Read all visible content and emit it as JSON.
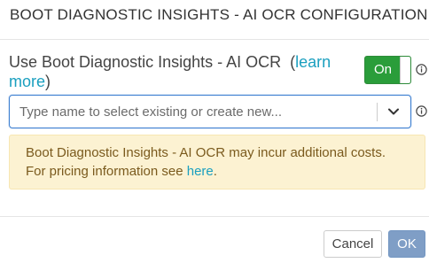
{
  "dialog": {
    "title": "BOOT DIAGNOSTIC INSIGHTS - AI OCR CONFIGURATION"
  },
  "setting": {
    "label": "Use Boot Diagnostic Insights - AI OCR",
    "paren_open": "(",
    "learn_more": "learn more",
    "paren_close": ")",
    "toggle_label": "On",
    "toggle_state": true,
    "toggle_color": "#2a9d3a"
  },
  "select": {
    "placeholder": "Type name to select existing or create new...",
    "value": "",
    "focus_color": "#3d7fd1"
  },
  "warning": {
    "text": "Boot Diagnostic Insights - AI OCR may incur additional costs. For pricing information see",
    "link": "here",
    "suffix": ".",
    "background": "#fcf2d2"
  },
  "footer": {
    "cancel_label": "Cancel",
    "ok_label": "OK",
    "ok_color": "#7f9ec6"
  },
  "icons": {
    "info": "info-circle-icon",
    "chevron": "chevron-down-icon"
  }
}
